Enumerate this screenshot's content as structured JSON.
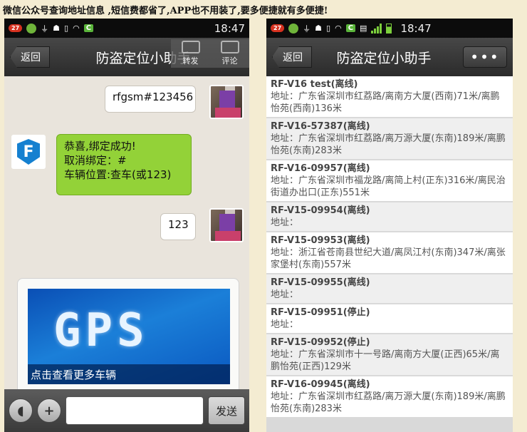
{
  "headline": "微信公众号查询地址信息 ,短信费都省了,APP也不用装了,要多便捷就有多便捷!",
  "status_bar": {
    "badge": "27",
    "c_label": "C",
    "time": "18:47"
  },
  "left": {
    "back_label": "返回",
    "title": "防盗定位小助手",
    "share_overlay": {
      "forward": "转发",
      "comment": "评论"
    },
    "messages": {
      "user_1": "rfgsm#123456",
      "bot_line_1": "恭喜,绑定成功!",
      "bot_line_2": "取消绑定：#",
      "bot_line_3": "车辆位置:查车(或123)",
      "user_2": "123",
      "bot_logo_letter": "F"
    },
    "card": {
      "image_text": "GPS",
      "caption": "点击查看更多车辆"
    },
    "input_bar": {
      "voice_icon": "voice-icon",
      "plus_icon": "plus-icon",
      "send_label": "发送"
    }
  },
  "right": {
    "back_label": "返回",
    "title": "防盗定位小助手",
    "more_label": "•••",
    "vehicles": [
      {
        "name": "RF-V16 test(离线)",
        "address": "地址：广东省深圳市红荔路/离南方大厦(西南)71米/离鹏怡苑(西南)136米"
      },
      {
        "name": "RF-V16-57387(离线)",
        "address": "地址：广东省深圳市红荔路/离万源大厦(东南)189米/离鹏怡苑(东南)283米"
      },
      {
        "name": "RF-V16-09957(离线)",
        "address": "地址：广东省深圳市福龙路/离简上村(正东)316米/离民治街道办出口(正东)551米"
      },
      {
        "name": "RF-V15-09954(离线)",
        "address": "地址："
      },
      {
        "name": "RF-V15-09953(离线)",
        "address": "地址：浙江省苍南县世纪大道/离凤江村(东南)347米/离张家堡村(东南)557米"
      },
      {
        "name": "RF-V15-09955(离线)",
        "address": "地址："
      },
      {
        "name": "RF-V15-09951(停止)",
        "address": "地址："
      },
      {
        "name": "RF-V15-09952(停止)",
        "address": "地址：广东省深圳市十一号路/离南方大厦(正西)65米/离鹏怡苑(正西)129米"
      },
      {
        "name": "RF-V16-09945(离线)",
        "address": "地址：广东省深圳市红荔路/离万源大厦(东南)189米/离鹏怡苑(东南)283米"
      }
    ]
  }
}
